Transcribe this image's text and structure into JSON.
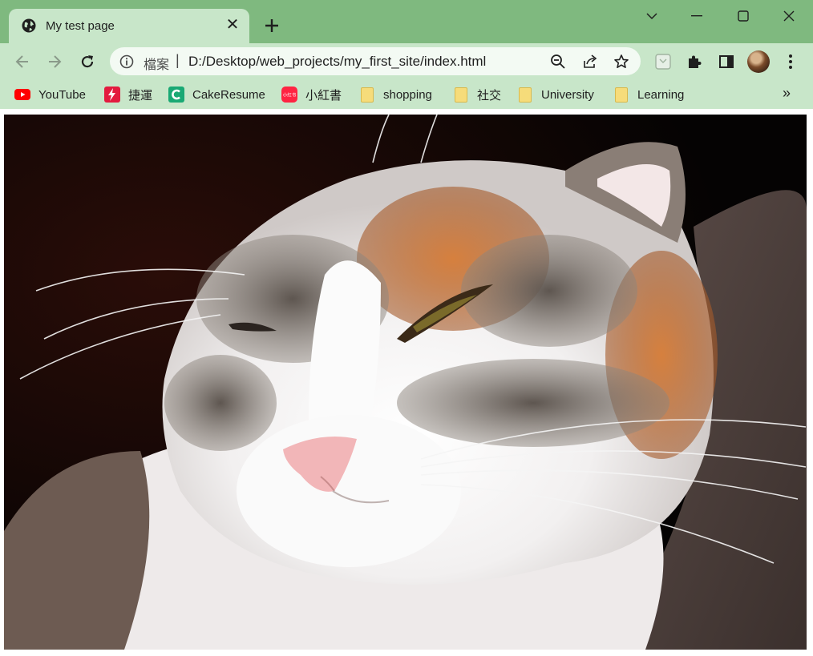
{
  "window": {
    "frame_color": "#7fb97f",
    "toolbar_color": "#c8e6c9"
  },
  "tab": {
    "title": "My test page",
    "favicon": "globe-icon"
  },
  "omnibox": {
    "scheme_label": "檔案",
    "url": "D:/Desktop/web_projects/my_first_site/index.html"
  },
  "bookmarks": [
    {
      "label": "YouTube",
      "icon": "youtube-icon",
      "color": "#ff0000"
    },
    {
      "label": "捷運",
      "icon": "bolt-icon",
      "color": "#e31b3f"
    },
    {
      "label": "CakeResume",
      "icon": "cakeresume-icon",
      "color": "#19a974"
    },
    {
      "label": "小紅書",
      "icon": "xiaohongshu-icon",
      "color": "#ff2442"
    },
    {
      "label": "shopping",
      "icon": "folder-icon"
    },
    {
      "label": "社交",
      "icon": "folder-icon"
    },
    {
      "label": "University",
      "icon": "folder-icon"
    },
    {
      "label": "Learning",
      "icon": "folder-icon"
    }
  ],
  "xiaohongshu_text": "小红书",
  "content": {
    "image_subject": "calico cat"
  }
}
